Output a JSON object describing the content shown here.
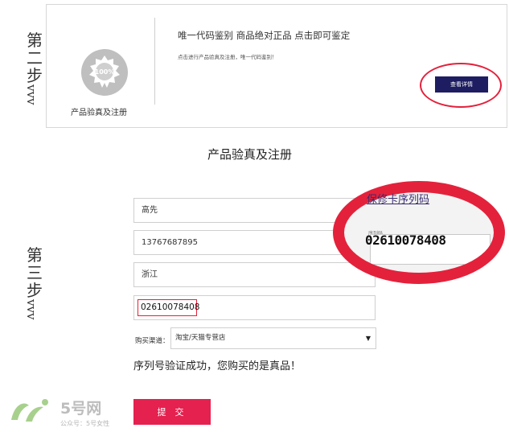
{
  "step2": {
    "label": "第二步",
    "arrows": "vvv"
  },
  "step3": {
    "label": "第三步",
    "arrows": "vvv"
  },
  "top_panel": {
    "badge_text": "100%",
    "badge_caption": "产品验真及注册",
    "title": "唯一代码鉴别 商品绝对正品 点击即可鉴定",
    "subtitle": "点击进行产品验真及注册，唯一代码鉴别！",
    "detail_button": "查看详情"
  },
  "form": {
    "title": "产品验真及注册",
    "name_value": "高先",
    "phone_value": "13767687895",
    "province_value": "浙江",
    "serial_value": "02610078408",
    "channel_label": "购买渠道：",
    "channel_value": "淘宝/天猫专营店",
    "success_text": "序列号验证成功，您购买的是真品！",
    "submit_button": "提 交"
  },
  "zoom": {
    "link_text": "保修卡序列码",
    "serial_label": "序列码",
    "serial_value": "02610078408"
  },
  "watermark": {
    "brand": "5号网",
    "sub": "公众号：5号女性"
  },
  "colors": {
    "accent_red": "#e4213b",
    "button_navy": "#1e1d62",
    "submit_pink": "#e4214f"
  }
}
